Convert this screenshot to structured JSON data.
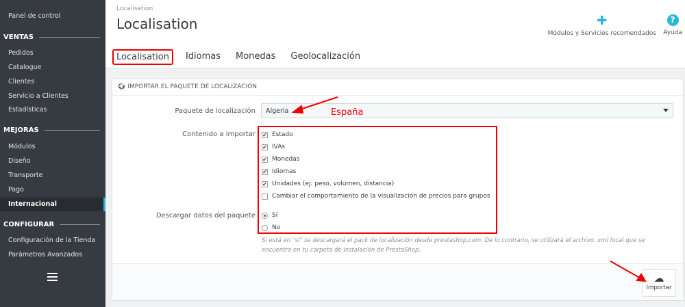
{
  "sidebar": {
    "dashboard": "Panel de control",
    "sections": [
      {
        "title": "VENTAS",
        "items": [
          "Pedidos",
          "Catalogue",
          "Clientes",
          "Servicio a Clientes",
          "Estadísticas"
        ]
      },
      {
        "title": "MEJORAS",
        "items": [
          "Módulos",
          "Diseño",
          "Transporte",
          "Pago",
          "Internacional"
        ]
      },
      {
        "title": "CONFIGURAR",
        "items": [
          "Configuración de la Tienda",
          "Parámetros Avanzados"
        ]
      }
    ],
    "active": "Internacional"
  },
  "header": {
    "breadcrumb": "Localisation",
    "title": "Localisation",
    "modules_label": "Módulos y Servicios recomendados",
    "help_label": "Ayuda"
  },
  "tabs": [
    "Localisation",
    "Idiomas",
    "Monedas",
    "Geolocalización"
  ],
  "panel": {
    "heading": "IMPORTAR EL PAQUETE DE LOCALIZACIÓN",
    "package_label": "Paquete de localización",
    "package_value": "Algeria",
    "content_label": "Contenido a importar",
    "content_options": [
      {
        "label": "Estado",
        "checked": true
      },
      {
        "label": "IVAs",
        "checked": true
      },
      {
        "label": "Monedas",
        "checked": true
      },
      {
        "label": "Idiomas",
        "checked": true
      },
      {
        "label": "Unidades (ej: peso, volumen, distancia)",
        "checked": true
      },
      {
        "label": "Cambiar el comportamiento de la visualización de precios para grupos",
        "checked": false
      }
    ],
    "download_label": "Descargar datos del paquete",
    "download_options": [
      {
        "label": "Sí",
        "selected": true
      },
      {
        "label": "No",
        "selected": false
      }
    ],
    "help": "Si está en \"si\" se descargará el pack de localización desde prestashop.com. De lo contrario, se utilizará el archivo .xml local que se encuentra en tu carpeta de instalación de PrestaShop.",
    "import_label": "Importar"
  },
  "annotation": {
    "note": "España",
    "color": "#ee0000"
  },
  "colors": {
    "sidebar": "#363a41",
    "accent": "#25b9d7"
  }
}
